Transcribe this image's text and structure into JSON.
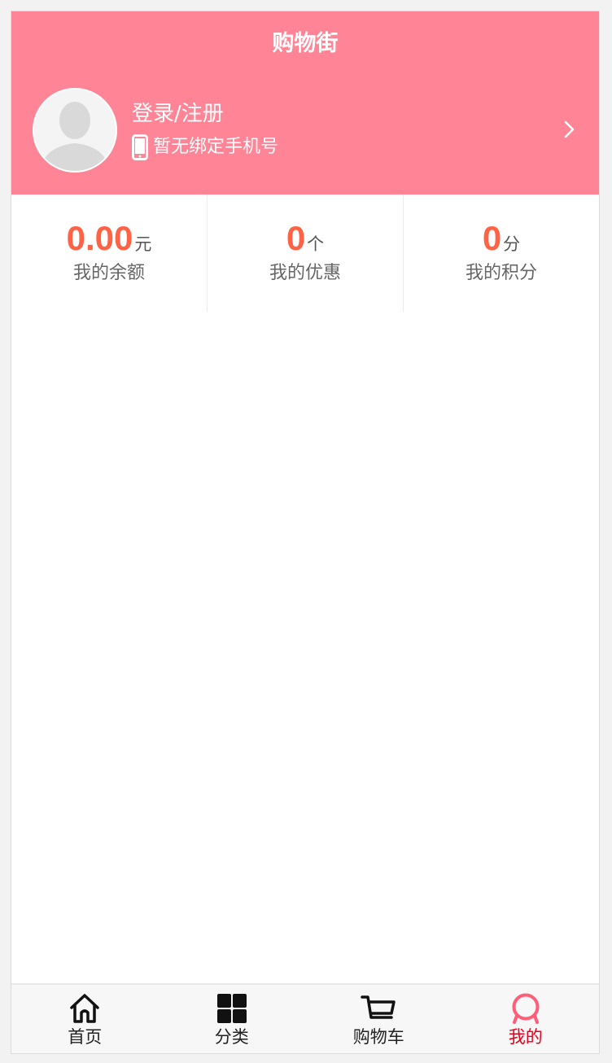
{
  "header": {
    "title": "购物街"
  },
  "profile": {
    "login_label": "登录/注册",
    "phone_label": "暂无绑定手机号"
  },
  "stats": [
    {
      "value": "0.00",
      "unit": "元",
      "label": "我的余额"
    },
    {
      "value": "0",
      "unit": "个",
      "label": "我的优惠"
    },
    {
      "value": "0",
      "unit": "分",
      "label": "我的积分"
    }
  ],
  "tabbar": {
    "items": [
      {
        "label": "首页",
        "icon": "home-icon"
      },
      {
        "label": "分类",
        "icon": "grid-icon"
      },
      {
        "label": "购物车",
        "icon": "cart-icon"
      },
      {
        "label": "我的",
        "icon": "profile-icon",
        "active": true
      }
    ]
  },
  "colors": {
    "header_bg": "#ff8596",
    "accent_value": "#ff6245",
    "active_tab": "#e8001c",
    "active_icon": "#ff5d78"
  }
}
